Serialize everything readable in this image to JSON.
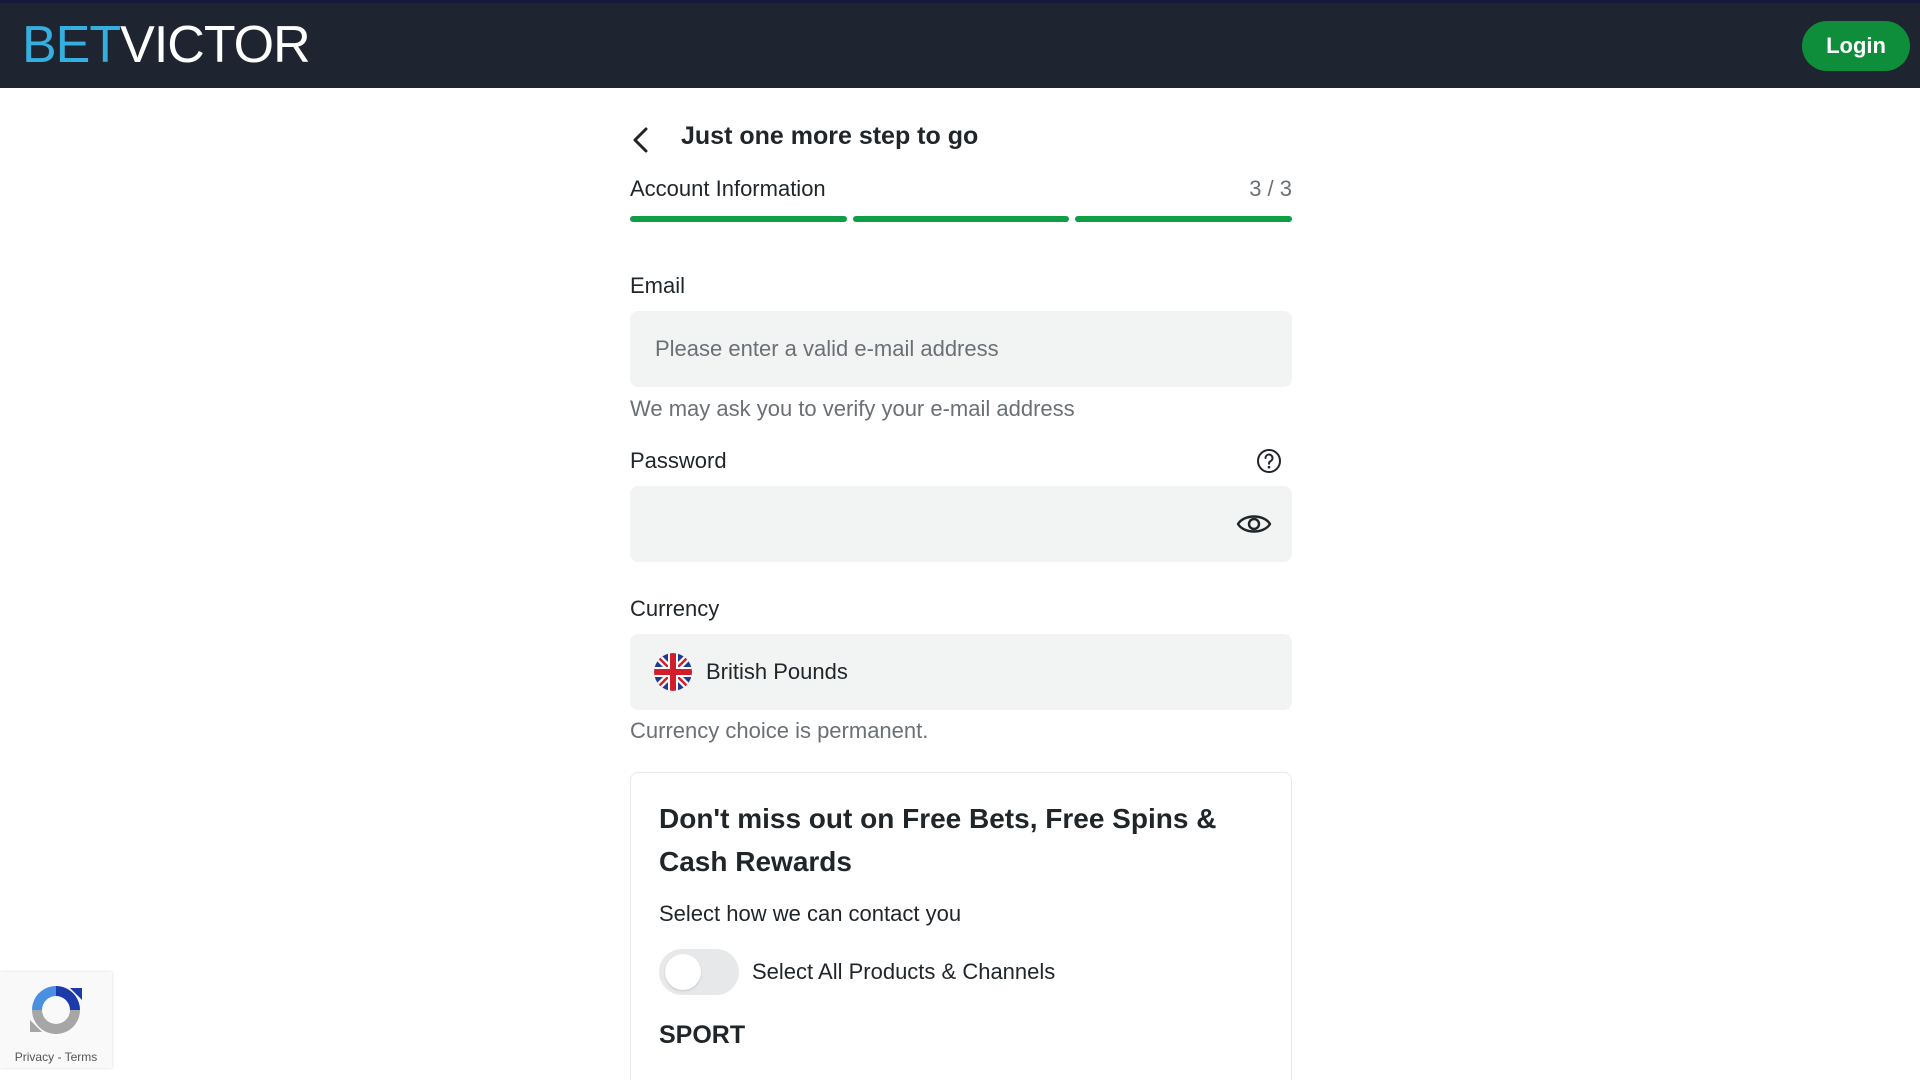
{
  "header": {
    "logo_part1": "BET",
    "logo_part2": "VICTOR",
    "login_label": "Login"
  },
  "step": {
    "title": "Just one more step to go",
    "section": "Account Information",
    "counter": "3 / 3",
    "progress_segments_complete": 3,
    "progress_segments_total": 3
  },
  "email": {
    "label": "Email",
    "placeholder": "Please enter a valid e-mail address",
    "value": "",
    "hint": "We may ask you to verify your e-mail address"
  },
  "password": {
    "label": "Password",
    "value": ""
  },
  "currency": {
    "label": "Currency",
    "value": "British Pounds",
    "hint": "Currency choice is permanent."
  },
  "promo": {
    "title": "Don't miss out on Free Bets, Free Spins & Cash Rewards",
    "subtitle": "Select how we can contact you",
    "toggle_label": "Select All Products & Channels",
    "toggle_on": false,
    "sport_heading": "SPORT"
  },
  "recaptcha": {
    "privacy": "Privacy",
    "separator": " - ",
    "terms": "Terms"
  },
  "colors": {
    "header_bg": "#1f2530",
    "brand_blue": "#35aee0",
    "login_green": "#0e8d3b",
    "progress_green": "#0e9f44",
    "input_bg": "#f2f3f3"
  },
  "icons": [
    "back-chevron-icon",
    "help-question-icon",
    "eye-icon",
    "uk-flag-icon",
    "recaptcha-icon"
  ]
}
